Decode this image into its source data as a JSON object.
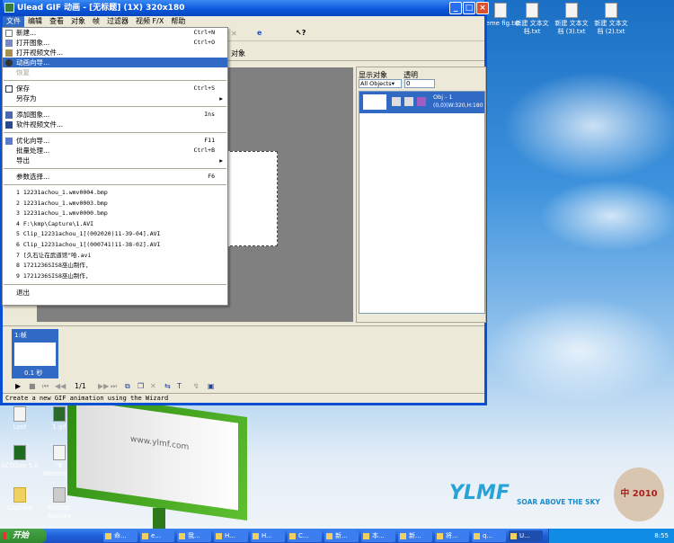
{
  "window": {
    "title": "Ulead GIF 动画 - [无标题] (1X) 320x180",
    "minimize": "_",
    "maximize": "□",
    "close": "×"
  },
  "menubar": [
    "文件",
    "编辑",
    "查看",
    "对象",
    "帧",
    "过滤器",
    "视频 F/X",
    "帮助"
  ],
  "tab_fragment": "对象",
  "file_menu": {
    "items": [
      {
        "label": "新建...",
        "shortcut": "Ctrl+N"
      },
      {
        "label": "打开图象...",
        "shortcut": "Ctrl+O"
      },
      {
        "label": "打开视频文件...",
        "shortcut": ""
      },
      {
        "label": "动画向导...",
        "shortcut": ""
      },
      {
        "label": "恢复",
        "shortcut": ""
      },
      {
        "label": "保存",
        "shortcut": "Ctrl+S"
      },
      {
        "label": "另存为",
        "shortcut": ""
      },
      {
        "label": "添加图象...",
        "shortcut": "Ins"
      },
      {
        "label": "软件视频文件...",
        "shortcut": ""
      },
      {
        "label": "优化向导...",
        "shortcut": "F11"
      },
      {
        "label": "批量处理...",
        "shortcut": "Ctrl+B"
      },
      {
        "label": "导出",
        "shortcut": ""
      },
      {
        "label": "参数选择...",
        "shortcut": "F6"
      },
      {
        "label": "退出",
        "shortcut": ""
      }
    ],
    "recent": [
      "1 12231achou_1.wmv0004.bmp",
      "2 12231achou_1.wmv0003.bmp",
      "3 12231achou_1.wmv0000.bmp",
      "4 F:\\kmp\\Capture\\1.AVI",
      "5 Clip_12231achou_1[(002020)11-39-04].AVI",
      "6 Clip_12231achou_1[(000741)11-38-02].AVI",
      "7 [久石让在武道馆\"哈.avi",
      "8 1721236SIS8巫山制作,",
      "9 1721236SIS8巫山制作,"
    ]
  },
  "object_panel": {
    "show_label": "显示对象",
    "opacity_label": "透明",
    "filter_value": "All Objects",
    "opacity_value": "0",
    "obj_name": "Obj - 1",
    "obj_info": "(0,0)(W:320,H:180"
  },
  "frame_panel": {
    "frame_label": "1:帧",
    "frame_delay": "0.1 秒",
    "frame_counter": "1/1"
  },
  "status": "Create a new GIF animation using the Wizard",
  "desktop_icons": [
    "treme fig.txt",
    "新建 文本文档.txt",
    "新建 文本文档 (3).txt",
    "新建 文本文档 (2).txt",
    "Lost",
    "1.gif",
    "ACDSee 5.0",
    "\"E Whereas...",
    "Capture",
    "Format Factory"
  ],
  "wallpaper": {
    "brand": "YLMF",
    "slogan": "SOAR ABOVE THE SKY",
    "badge": "中 2010",
    "billboard": "www.ylmf.com"
  },
  "taskbar": {
    "start": "开始",
    "tasks": [
      "命...",
      "e...",
      "我...",
      "H...",
      "H...",
      "C...",
      "新...",
      "本...",
      "新...",
      "将...",
      "q...",
      "U..."
    ],
    "clock": "8:55"
  }
}
